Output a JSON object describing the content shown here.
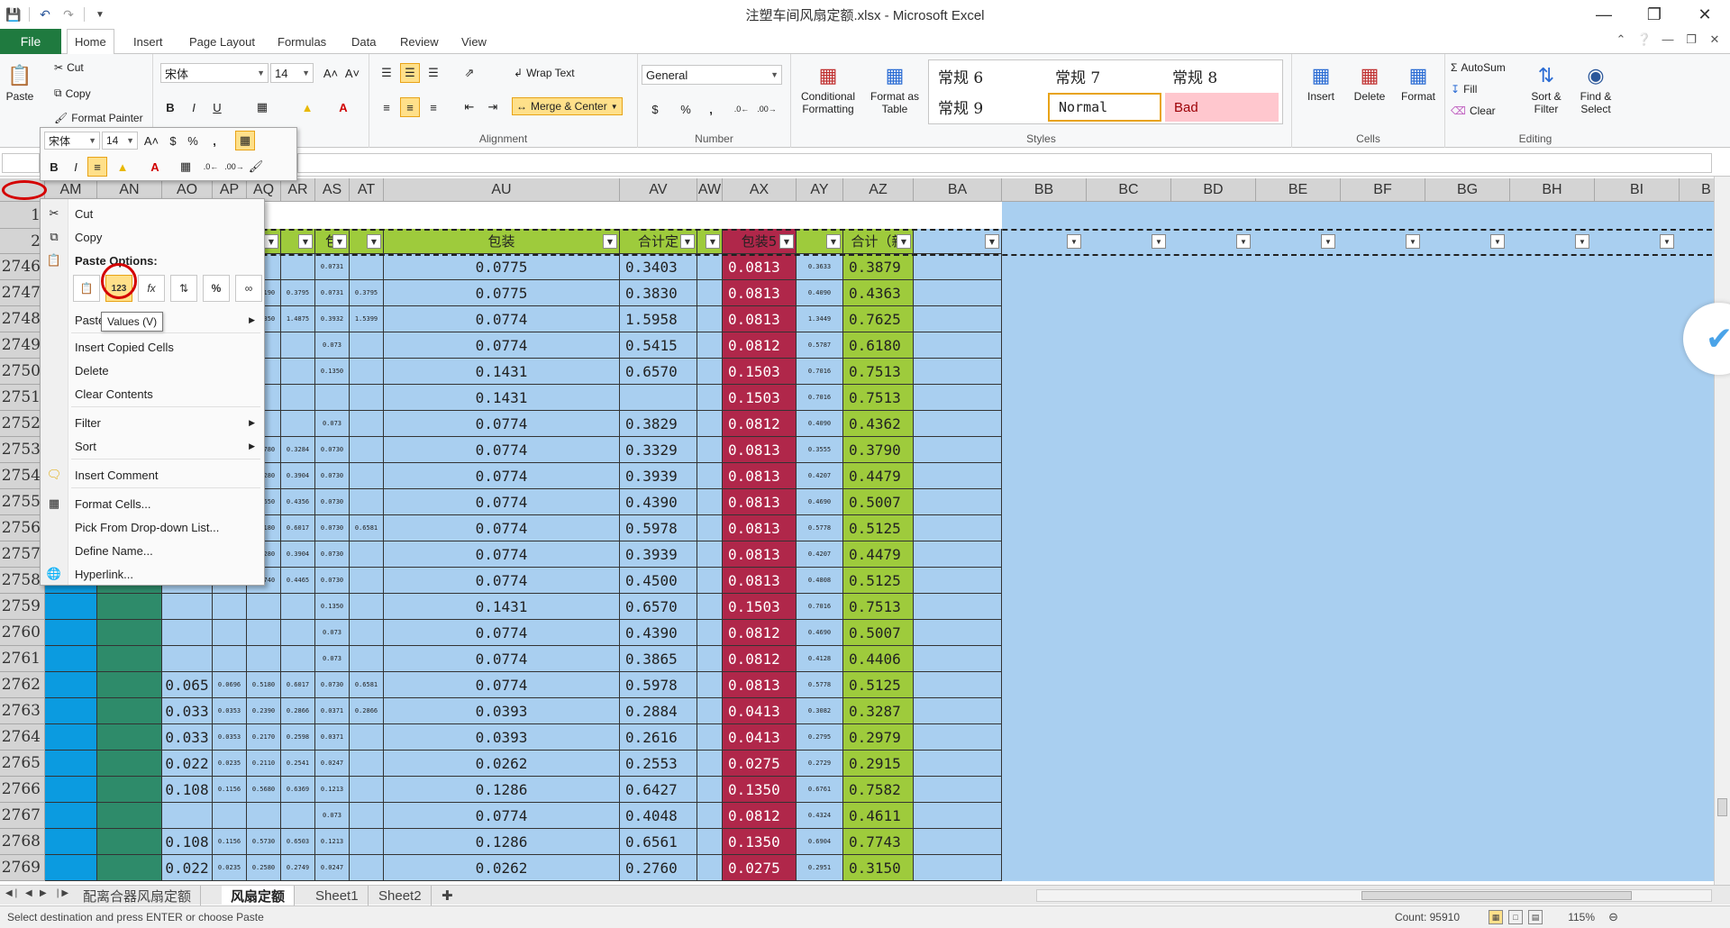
{
  "titlebar": {
    "title": "注塑车间风扇定额.xlsx - Microsoft Excel",
    "qat": [
      "save-icon",
      "undo-icon",
      "redo-icon",
      "customize-icon"
    ]
  },
  "tabs": {
    "file": "File",
    "items": [
      "Home",
      "Insert",
      "Page Layout",
      "Formulas",
      "Data",
      "Review",
      "View"
    ],
    "active": "Home"
  },
  "ribbon": {
    "clipboard": {
      "paste": "Paste",
      "cut": "Cut",
      "copy": "Copy",
      "format_painter": "Format Painter",
      "label": "Clipboard"
    },
    "font": {
      "name": "宋体",
      "size": "14",
      "label": "Font"
    },
    "alignment": {
      "wrap": "Wrap Text",
      "merge": "Merge & Center",
      "label": "Alignment"
    },
    "number": {
      "format": "General",
      "label": "Number"
    },
    "styles": {
      "conditional": "Conditional Formatting",
      "format_table": "Format as Table",
      "cells": [
        "常规 6",
        "常规 7",
        "常规 8",
        "常规 9",
        "Normal",
        "Bad"
      ],
      "label": "Styles"
    },
    "cells": {
      "insert": "Insert",
      "delete": "Delete",
      "format": "Format",
      "label": "Cells"
    },
    "editing": {
      "autosum": "AutoSum",
      "fill": "Fill",
      "clear": "Clear",
      "sort": "Sort & Filter",
      "find": "Find & Select",
      "label": "Editing"
    }
  },
  "mini_toolbar": {
    "font": "宋体",
    "size": "14"
  },
  "columns": [
    "AM",
    "AN",
    "AO",
    "AP",
    "AQ",
    "AR",
    "AS",
    "AT",
    "AU",
    "AV",
    "AW",
    "AX",
    "AY",
    "AZ",
    "BA",
    "BB",
    "BC",
    "BD",
    "BE",
    "BF",
    "BG",
    "BH",
    "BI",
    "B"
  ],
  "header_row": {
    "as": "包",
    "au": "包装",
    "av": "合计定",
    "ax": "包装5",
    "az": "合计（新"
  },
  "rows": [
    {
      "n": "1"
    },
    {
      "n": "2"
    },
    {
      "n": "2746",
      "ao": "",
      "aq": "",
      "ar": "",
      "as": "0.0731",
      "at": "",
      "au": "0.0775",
      "av": "0.3403",
      "ax": "0.0813",
      "ay": "0.3633",
      "az": "0.3879"
    },
    {
      "n": "2747",
      "ao": "",
      "aq": "0.3190",
      "ar": "0.3795",
      "as": "0.0731",
      "at": "0.3795",
      "au": "0.0775",
      "av": "0.3830",
      "ax": "0.0813",
      "ay": "0.4090",
      "az": "0.4363"
    },
    {
      "n": "2748",
      "ao": "",
      "aq": "1.3350",
      "ar": "1.4875",
      "as": "0.3932",
      "at": "1.5399",
      "au": "0.0774",
      "av": "1.5958",
      "ax": "0.0813",
      "ay": "1.3449",
      "az": "0.7625"
    },
    {
      "n": "2749",
      "ao": "",
      "aq": "",
      "ar": "",
      "as": "0.073",
      "at": "",
      "au": "0.0774",
      "av": "0.5415",
      "ax": "0.0812",
      "ay": "0.5787",
      "az": "0.6180"
    },
    {
      "n": "2750",
      "ao": "",
      "aq": "",
      "ar": "",
      "as": "0.1350",
      "at": "",
      "au": "0.1431",
      "av": "0.6570",
      "ax": "0.1503",
      "ay": "0.7016",
      "az": "0.7513"
    },
    {
      "n": "2751",
      "ao": "",
      "aq": "",
      "ar": "",
      "as": "",
      "at": "",
      "au": "0.1431",
      "av": "",
      "ax": "0.1503",
      "ay": "0.7016",
      "az": "0.7513"
    },
    {
      "n": "2752",
      "ao": "",
      "aq": "",
      "ar": "",
      "as": "0.073",
      "at": "",
      "au": "0.0774",
      "av": "0.3829",
      "ax": "0.0812",
      "ay": "0.4090",
      "az": "0.4362"
    },
    {
      "n": "2753",
      "ao": "",
      "aq": "0.2780",
      "ar": "0.3284",
      "as": "0.0730",
      "at": "",
      "au": "0.0774",
      "av": "0.3329",
      "ax": "0.0813",
      "ay": "0.3555",
      "az": "0.3790"
    },
    {
      "n": "2754",
      "ao": "",
      "aq": "0.3280",
      "ar": "0.3904",
      "as": "0.0730",
      "at": "",
      "au": "0.0774",
      "av": "0.3939",
      "ax": "0.0813",
      "ay": "0.4207",
      "az": "0.4479"
    },
    {
      "n": "2755",
      "ao": "",
      "aq": "0.3650",
      "ar": "0.4356",
      "as": "0.0730",
      "at": "",
      "au": "0.0774",
      "av": "0.4390",
      "ax": "0.0813",
      "ay": "0.4690",
      "az": "0.5007"
    },
    {
      "n": "2756",
      "ao": "",
      "aq": "0.5180",
      "ar": "0.6017",
      "as": "0.0730",
      "at": "0.6581",
      "au": "0.0774",
      "av": "0.5978",
      "ax": "0.0813",
      "ay": "0.5778",
      "az": "0.5125"
    },
    {
      "n": "2757",
      "ao": "",
      "aq": "0.3280",
      "ar": "0.3904",
      "as": "0.0730",
      "at": "",
      "au": "0.0774",
      "av": "0.3939",
      "ax": "0.0813",
      "ay": "0.4207",
      "az": "0.4479"
    },
    {
      "n": "2758",
      "ao": "",
      "aq": "0.3740",
      "ar": "0.4465",
      "as": "0.0730",
      "at": "",
      "au": "0.0774",
      "av": "0.4500",
      "ax": "0.0813",
      "ay": "0.4808",
      "az": "0.5125"
    },
    {
      "n": "2759",
      "ao": "",
      "aq": "",
      "ar": "",
      "as": "0.1350",
      "at": "",
      "au": "0.1431",
      "av": "0.6570",
      "ax": "0.1503",
      "ay": "0.7016",
      "az": "0.7513"
    },
    {
      "n": "2760",
      "ao": "",
      "aq": "",
      "ar": "",
      "as": "0.073",
      "at": "",
      "au": "0.0774",
      "av": "0.4390",
      "ax": "0.0812",
      "ay": "0.4690",
      "az": "0.5007"
    },
    {
      "n": "2761",
      "ao": "",
      "aq": "",
      "ar": "",
      "as": "0.073",
      "at": "",
      "au": "0.0774",
      "av": "0.3865",
      "ax": "0.0812",
      "ay": "0.4128",
      "az": "0.4406"
    },
    {
      "n": "2762",
      "ao": "0.065",
      "ap": "0.0696",
      "aq": "0.5180",
      "ar": "0.6017",
      "as": "0.0730",
      "at": "0.6581",
      "au": "0.0774",
      "av": "0.5978",
      "ax": "0.0813",
      "ay": "0.5778",
      "az": "0.5125"
    },
    {
      "n": "2763",
      "ao": "0.033",
      "ap": "0.0353",
      "aq": "0.2390",
      "ar": "0.2866",
      "as": "0.0371",
      "at": "0.2866",
      "au": "0.0393",
      "av": "0.2884",
      "ax": "0.0413",
      "ay": "0.3082",
      "az": "0.3287"
    },
    {
      "n": "2764",
      "ao": "0.033",
      "ap": "0.0353",
      "aq": "0.2170",
      "ar": "0.2598",
      "as": "0.0371",
      "at": "",
      "au": "0.0393",
      "av": "0.2616",
      "ax": "0.0413",
      "ay": "0.2795",
      "az": "0.2979"
    },
    {
      "n": "2765",
      "ao": "0.022",
      "ap": "0.0235",
      "aq": "0.2110",
      "ar": "0.2541",
      "as": "0.0247",
      "at": "",
      "au": "0.0262",
      "av": "0.2553",
      "ax": "0.0275",
      "ay": "0.2729",
      "az": "0.2915"
    },
    {
      "n": "2766",
      "ao": "0.108",
      "ap": "0.1156",
      "aq": "0.5680",
      "ar": "0.6369",
      "as": "0.1213",
      "at": "",
      "au": "0.1286",
      "av": "0.6427",
      "ax": "0.1350",
      "ay": "0.6761",
      "az": "0.7582"
    },
    {
      "n": "2767",
      "ao": "",
      "ap": "",
      "aq": "",
      "ar": "",
      "as": "0.073",
      "at": "",
      "au": "0.0774",
      "av": "0.4048",
      "ax": "0.0812",
      "ay": "0.4324",
      "az": "0.4611"
    },
    {
      "n": "2768",
      "ao": "0.108",
      "ap": "0.1156",
      "aq": "0.5730",
      "ar": "0.6503",
      "as": "0.1213",
      "at": "",
      "au": "0.1286",
      "av": "0.6561",
      "ax": "0.1350",
      "ay": "0.6904",
      "az": "0.7743"
    },
    {
      "n": "2769",
      "ao": "0.022",
      "ap": "0.0235",
      "aq": "0.2580",
      "ar": "0.2749",
      "as": "0.0247",
      "at": "",
      "au": "0.0262",
      "av": "0.2760",
      "ax": "0.0275",
      "ay": "0.2951",
      "az": "0.3150"
    }
  ],
  "context_menu": {
    "cut": "Cut",
    "copy": "Copy",
    "paste_options": "Paste Options:",
    "paste_icons": [
      "paste-icon",
      "paste-values-icon",
      "paste-formulas-icon",
      "paste-transpose-icon",
      "paste-formatting-icon",
      "paste-link-icon"
    ],
    "paste_special": "Paste Special...",
    "insert_copied": "Insert Copied Cells",
    "delete": "Delete",
    "clear_contents": "Clear Contents",
    "filter": "Filter",
    "sort": "Sort",
    "insert_comment": "Insert Comment",
    "format_cells": "Format Cells...",
    "pick_dropdown": "Pick From Drop-down List...",
    "define_name": "Define Name...",
    "hyperlink": "Hyperlink..."
  },
  "tooltip": "Values (V)",
  "sheets": [
    "配离合器风扇定额",
    "风扇定额",
    "Sheet1",
    "Sheet2"
  ],
  "active_sheet": "风扇定额",
  "status": {
    "message": "Select destination and press ENTER or choose Paste",
    "count": "Count: 95910",
    "zoom": "115%"
  },
  "colors": {
    "grid_blue": "#a9cff0",
    "am_blue": "#0b9be0",
    "an_green": "#2e8b6a",
    "ax_red": "#b0274a",
    "az_green": "#9ecb3c",
    "header_green": "#9ecb3c"
  }
}
